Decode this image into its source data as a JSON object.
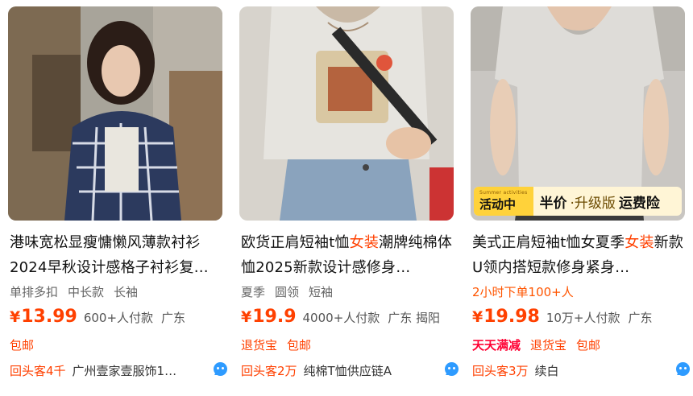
{
  "products": [
    {
      "title": "港味宽松显瘦慵懒风薄款衬衫2024早秋设计感格子衬衫复…",
      "title_highlight": "",
      "tags": [
        "单排多扣",
        "中长款",
        "长袖"
      ],
      "price_currency": "¥",
      "price": "13.99",
      "paid": "600+人付款",
      "location": "广东",
      "badges": [
        "包邮"
      ],
      "repeat": "回头客4千",
      "shop": "广州壹家壹服饰1…"
    },
    {
      "title_pre": "欧货正肩短袖t恤",
      "title_highlight": "女装",
      "title_post": "潮牌纯棉体恤2025新款设计感修身…",
      "tags": [
        "夏季",
        "圆领",
        "短袖"
      ],
      "price_currency": "¥",
      "price": "19.9",
      "paid": "4000+人付款",
      "location": "广东 揭阳",
      "badges": [
        "退货宝",
        "包邮"
      ],
      "repeat": "回头客2万",
      "shop": "纯棉T恤供应链A"
    },
    {
      "title_pre": "美式正肩短袖t恤女夏季",
      "title_highlight": "女装",
      "title_post": "新款U领内搭短款修身紧身…",
      "sold_text": "2小时下单100+人",
      "price_currency": "¥",
      "price": "19.98",
      "paid": "10万+人付款",
      "location": "广东",
      "badges": [
        "天天满减",
        "退货宝",
        "包邮"
      ],
      "repeat": "回头客3万",
      "shop": "续白",
      "banner": {
        "small": "Summer activities",
        "activity": "活动中",
        "half": "半价",
        "upgrade": "·升级版",
        "free_shipping": "运费险"
      }
    }
  ],
  "colors": {
    "accent": "#ff4000",
    "strong_badge": "#ff0033",
    "chat_icon": "#2e9bff"
  }
}
